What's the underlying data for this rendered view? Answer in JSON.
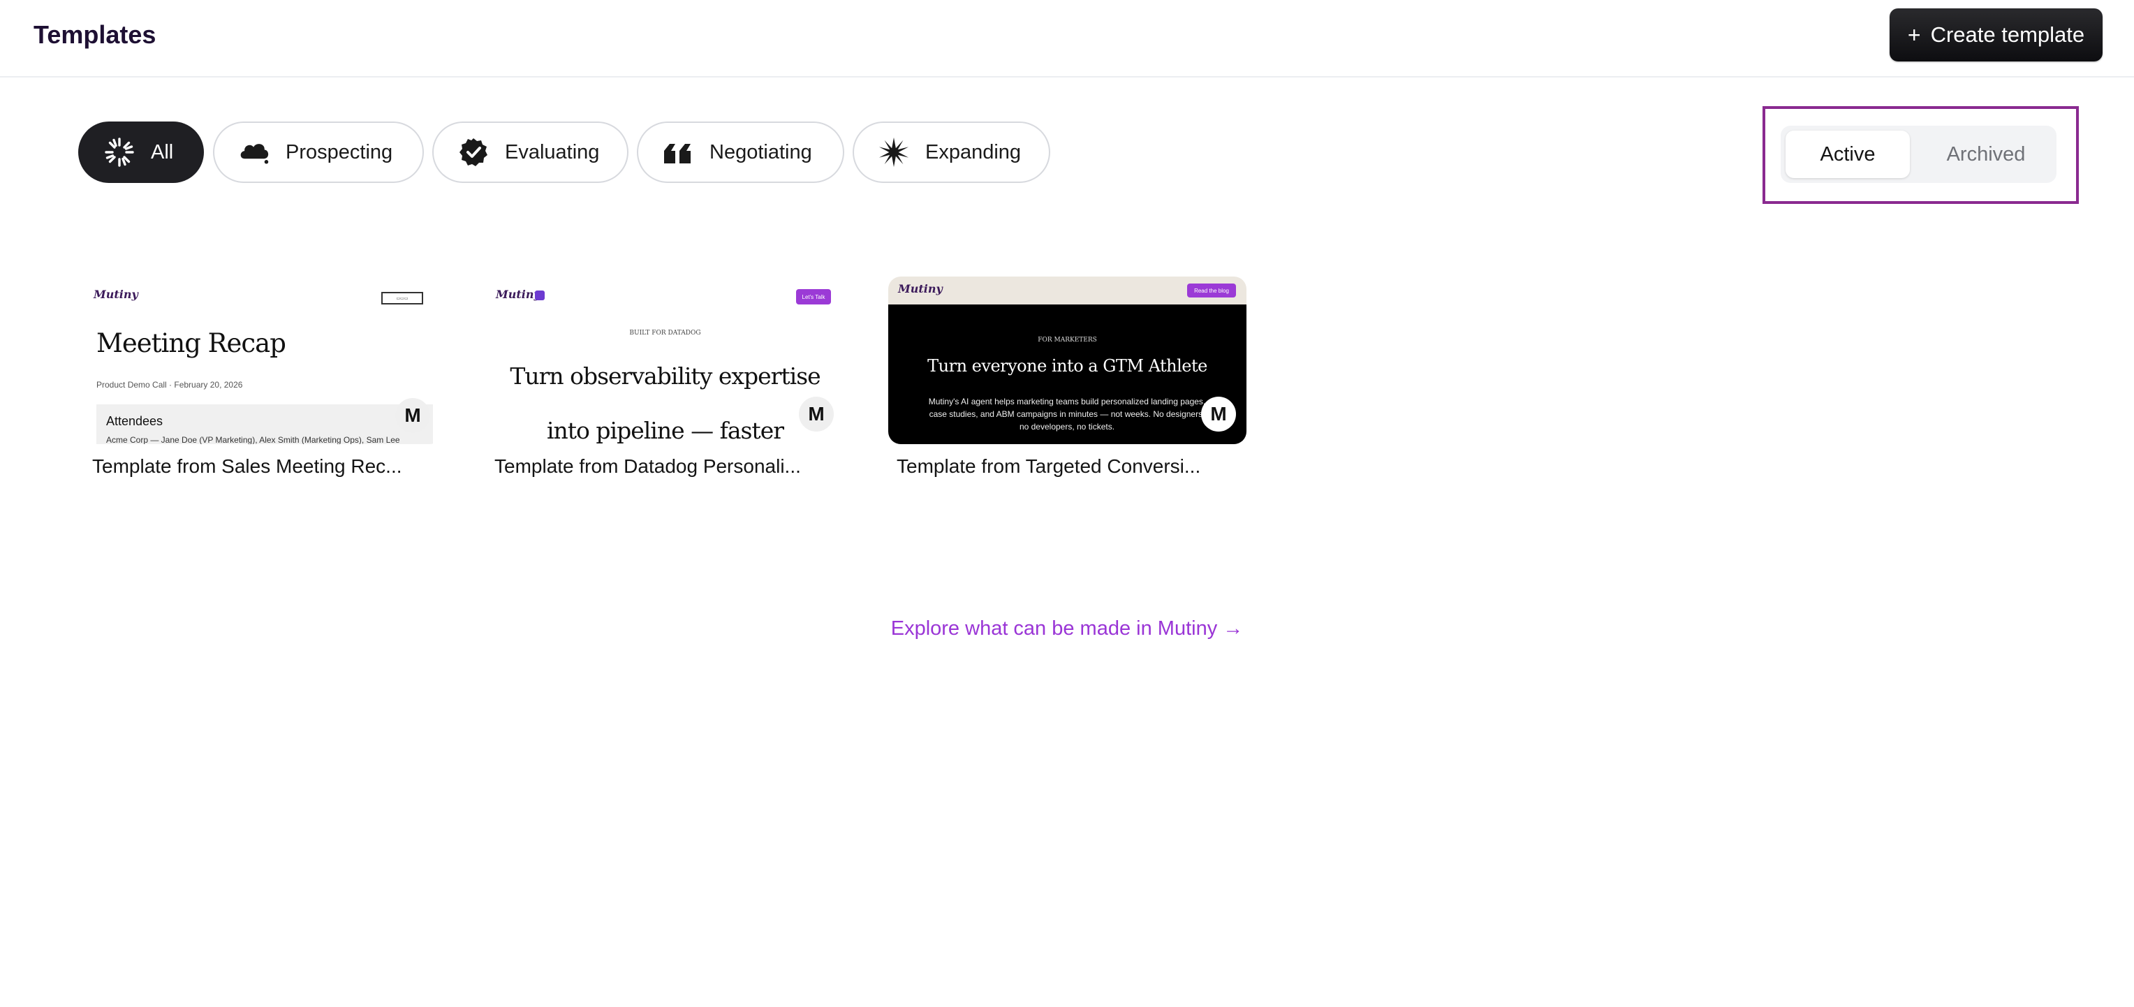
{
  "header": {
    "title": "Templates",
    "create_label": "Create template",
    "create_icon": "plus-icon"
  },
  "filters": [
    {
      "label": "All",
      "icon": "spinner-burst-icon",
      "selected": true
    },
    {
      "label": "Prospecting",
      "icon": "cloud-icon",
      "selected": false
    },
    {
      "label": "Evaluating",
      "icon": "badge-check-icon",
      "selected": false
    },
    {
      "label": "Negotiating",
      "icon": "quote-icon",
      "selected": false
    },
    {
      "label": "Expanding",
      "icon": "starburst-icon",
      "selected": false
    }
  ],
  "status_toggle": {
    "active_label": "Active",
    "archived_label": "Archived",
    "selected": "Active",
    "highlight_color": "#8a2a90"
  },
  "templates": [
    {
      "name": "Template from Sales Meeting Rec...",
      "preview": {
        "logo": "Mutiny",
        "title": "Meeting Recap",
        "subtitle": "Product Demo Call · February 20, 2026",
        "section": "Attendees",
        "names": "Acme Corp — Jane Doe (VP Marketing), Alex Smith (Marketing Ops), Sam Lee"
      },
      "badge": "M"
    },
    {
      "name": "Template from Datadog Personali...",
      "preview": {
        "logo": "Mutiny",
        "cta": "Let's Talk",
        "kicker": "BUILT FOR DATADOG",
        "headline_line1": "Turn observability expertise",
        "headline_line2": "into pipeline — faster"
      },
      "badge": "M"
    },
    {
      "name": "Template from Targeted Conversi...",
      "preview": {
        "logo": "Mutiny",
        "cta": "Read the blog",
        "kicker": "FOR MARKETERS",
        "headline": "Turn everyone into a GTM Athlete",
        "description": "Mutiny's AI agent helps marketing teams build personalized landing pages, case studies, and ABM campaigns in minutes — not weeks. No designers, no developers, no tickets."
      },
      "badge": "M"
    }
  ],
  "explore_link": "Explore what can be made in Mutiny →",
  "colors": {
    "accent": "#9a35d6",
    "dark_button": "#1f1f23",
    "title": "#1e1033"
  }
}
